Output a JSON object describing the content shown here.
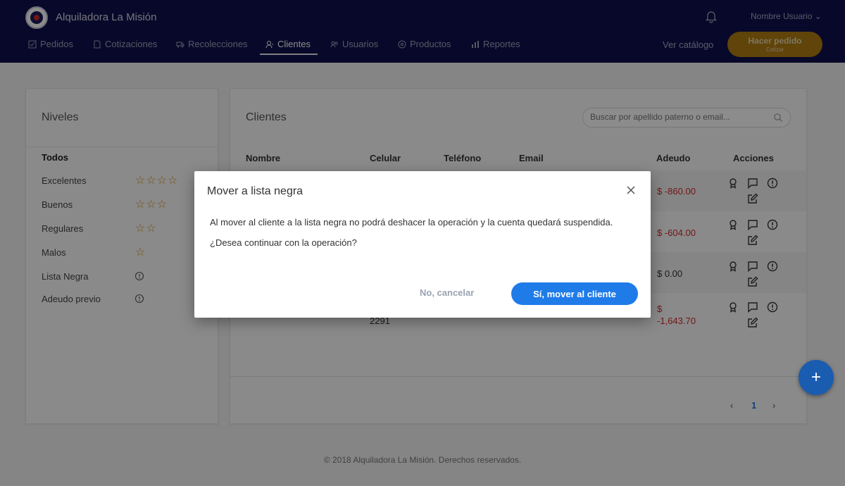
{
  "header": {
    "brand": "Alquiladora La Misión",
    "user_name": "Nombre Usuario",
    "nav": [
      {
        "label": "Pedidos",
        "icon": "check-square-icon"
      },
      {
        "label": "Cotizaciones",
        "icon": "document-icon"
      },
      {
        "label": "Recolecciones",
        "icon": "truck-icon"
      },
      {
        "label": "Clientes",
        "icon": "user-icon",
        "active": true
      },
      {
        "label": "Usuarios",
        "icon": "users-icon"
      },
      {
        "label": "Productos",
        "icon": "tag-icon"
      },
      {
        "label": "Reportes",
        "icon": "bar-chart-icon"
      }
    ],
    "ver_catalogo": "Ver catálogo",
    "order_button": {
      "label": "Hacer pedido",
      "sublabel": "Cotizar"
    }
  },
  "levels": {
    "title": "Niveles",
    "items": [
      {
        "label": "Todos",
        "stars": 0
      },
      {
        "label": "Excelentes",
        "stars": 4
      },
      {
        "label": "Buenos",
        "stars": 3
      },
      {
        "label": "Regulares",
        "stars": 2
      },
      {
        "label": "Malos",
        "stars": 1
      },
      {
        "label": "Lista Negra",
        "icon": "info-icon"
      },
      {
        "label": "Adeudo previo",
        "icon": "info-icon"
      }
    ]
  },
  "clients": {
    "title": "Clientes",
    "search_placeholder": "Buscar por apellido paterno o email...",
    "columns": [
      "Nombre",
      "Celular",
      "Teléfono",
      "Email",
      "Adeudo",
      "Acciones"
    ],
    "rows": [
      {
        "adeudo": "$ -860.00"
      },
      {
        "adeudo": "$ -604.00"
      },
      {
        "adeudo": "$ 0.00"
      },
      {
        "adeudo_line1": "$",
        "adeudo_line2": "-1,643.70",
        "celular_partial": "2291"
      }
    ],
    "pagination": {
      "current": "1"
    }
  },
  "footer": "© 2018 Alquiladora La Misión. Derechos reservados.",
  "modal": {
    "title": "Mover a lista negra",
    "body_line1": "Al mover al cliente a la lista negra no podrá deshacer la operación y la cuenta quedará suspendida.",
    "body_line2": "¿Desea continuar con la operación?",
    "cancel_label": "No, cancelar",
    "confirm_label": "Sí, mover al cliente"
  },
  "colors": {
    "header_bg": "#0f0f4d",
    "accent_gold": "#b07d12",
    "primary_blue": "#1f7be8",
    "debt_red": "#d12a2a",
    "star_orange": "#d9911c"
  }
}
